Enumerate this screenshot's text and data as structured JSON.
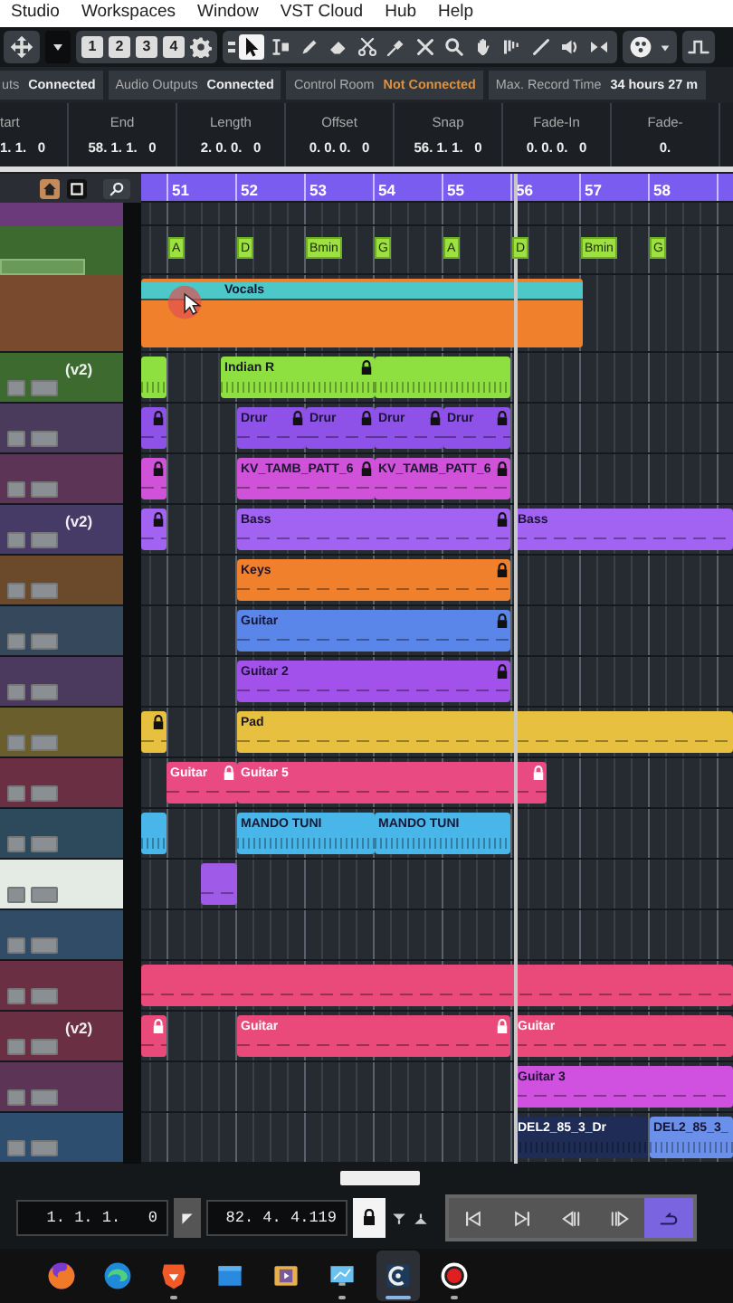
{
  "menu": [
    "Studio",
    "Workspaces",
    "Window",
    "VST Cloud",
    "Hub",
    "Help"
  ],
  "toolbar": {
    "keys": [
      "1",
      "2",
      "3",
      "4"
    ],
    "tools": [
      {
        "kind": "select",
        "selected": true
      },
      {
        "kind": "range",
        "selected": false
      },
      {
        "kind": "pencil",
        "selected": false
      },
      {
        "kind": "eraser",
        "selected": false
      },
      {
        "kind": "scissors",
        "selected": false
      },
      {
        "kind": "glue",
        "selected": false
      },
      {
        "kind": "mute",
        "selected": false
      },
      {
        "kind": "zoom",
        "selected": false
      },
      {
        "kind": "hand",
        "selected": false
      },
      {
        "kind": "comp",
        "selected": false
      },
      {
        "kind": "line",
        "selected": false
      },
      {
        "kind": "speaker",
        "selected": false
      },
      {
        "kind": "play",
        "selected": false
      }
    ]
  },
  "connections": [
    {
      "label": "uts",
      "value": "Connected",
      "connected": true
    },
    {
      "label": "Audio Outputs",
      "value": "Connected",
      "connected": true
    },
    {
      "label": "Control Room",
      "value": "Not Connected",
      "connected": false
    }
  ],
  "record_time": {
    "label": "Max. Record Time",
    "value": "34 hours 27 m"
  },
  "info_line": [
    {
      "label": "tart",
      "value": "1. 1.   0"
    },
    {
      "label": "End",
      "value": "58. 1. 1.   0"
    },
    {
      "label": "Length",
      "value": "2. 0. 0.   0"
    },
    {
      "label": "Offset",
      "value": "0. 0. 0.   0"
    },
    {
      "label": "Snap",
      "value": "56. 1. 1.   0"
    },
    {
      "label": "Fade-In",
      "value": "0. 0. 0.   0"
    },
    {
      "label": "Fade-",
      "value": "0."
    }
  ],
  "ruler": {
    "bars": [
      "51",
      "52",
      "53",
      "54",
      "55",
      "56",
      "57",
      "58"
    ]
  },
  "chords": [
    {
      "label": "A"
    },
    {
      "label": "D"
    },
    {
      "label": "Bmin"
    },
    {
      "label": "G"
    },
    {
      "label": "A"
    },
    {
      "label": "D"
    },
    {
      "label": "Bmin"
    },
    {
      "label": "G"
    }
  ],
  "tracks": [
    {
      "color": "#7a4a2e",
      "events": [
        {
          "kind": "comped",
          "label": "Vocals",
          "color": "#f0802c",
          "locked": false
        }
      ]
    },
    {
      "color": "#3d6b2f",
      "version": "(v2)",
      "events": [
        {
          "kind": "audio",
          "color": "#8ee040",
          "locked": false
        },
        {
          "kind": "audio",
          "label": "Indian R",
          "color": "#8ee040",
          "locked": true
        },
        {
          "kind": "audio",
          "color": "#8ee040",
          "locked": false
        }
      ]
    },
    {
      "color": "#4a3a5c",
      "events": [
        {
          "kind": "midi",
          "color": "#8f52e8",
          "locked": true
        },
        {
          "kind": "midi",
          "label": "Drur",
          "color": "#8f52e8",
          "locked": true
        },
        {
          "kind": "midi",
          "label": "Drur",
          "color": "#8f52e8",
          "locked": true
        },
        {
          "kind": "midi",
          "label": "Drur",
          "color": "#8f52e8",
          "locked": true
        },
        {
          "kind": "midi",
          "label": "Drur",
          "color": "#8f52e8",
          "locked": true
        }
      ]
    },
    {
      "color": "#5c3556",
      "events": [
        {
          "kind": "midi",
          "color": "#cf52d8",
          "locked": true
        },
        {
          "kind": "midi",
          "label": "KV_TAMB_PATT_6",
          "color": "#cf52d8",
          "locked": true
        },
        {
          "kind": "midi",
          "label": "KV_TAMB_PATT_6",
          "color": "#cf52d8",
          "locked": true
        }
      ]
    },
    {
      "color": "#463a66",
      "version": "(v2)",
      "events": [
        {
          "kind": "midi",
          "color": "#a262f2",
          "locked": true
        },
        {
          "kind": "midi",
          "label": "Bass",
          "color": "#a262f2",
          "locked": true
        },
        {
          "kind": "midi",
          "label": "Bass",
          "color": "#a262f2",
          "locked": false
        }
      ]
    },
    {
      "color": "#6b4a2c",
      "events": [
        {
          "kind": "midi",
          "label": "Keys",
          "color": "#f0802c",
          "locked": true
        }
      ]
    },
    {
      "color": "#35485c",
      "events": [
        {
          "kind": "midi",
          "label": "Guitar",
          "color": "#5a86ea",
          "locked": true
        }
      ]
    },
    {
      "color": "#4c3a5e",
      "events": [
        {
          "kind": "midi",
          "label": "Guitar 2",
          "color": "#a252ea",
          "locked": true
        }
      ]
    },
    {
      "color": "#6a5f2c",
      "events": [
        {
          "kind": "midi",
          "color": "#e8c040",
          "locked": true
        },
        {
          "kind": "midi",
          "label": "Pad",
          "color": "#e8c040",
          "locked": false
        }
      ]
    },
    {
      "color": "#6a2f42",
      "events": [
        {
          "kind": "midi",
          "label": "Guitar",
          "color": "#ea4a82",
          "locked": true
        },
        {
          "kind": "midi",
          "label": "Guitar 5",
          "color": "#ea4a82",
          "locked": true
        }
      ]
    },
    {
      "color": "#2c4a5c",
      "events": [
        {
          "kind": "audio",
          "color": "#48b6e8",
          "locked": false
        },
        {
          "kind": "audio",
          "label": "MANDO TUNI",
          "color": "#48b6e8",
          "locked": false
        },
        {
          "kind": "audio",
          "label": "MANDO TUNI",
          "color": "#48b6e8",
          "locked": false
        }
      ]
    },
    {
      "color": "#e4ebe4",
      "events": [
        {
          "kind": "midi",
          "color": "#a05ae8",
          "locked": false
        }
      ]
    },
    {
      "color": "#304c66"
    },
    {
      "color": "#6a2f42",
      "events": [
        {
          "kind": "midi",
          "color": "#ea4a7a",
          "locked": false
        }
      ]
    },
    {
      "color": "#6a2f42",
      "version": "(v2)",
      "events": [
        {
          "kind": "midi",
          "color": "#ea4a7a",
          "locked": true
        },
        {
          "kind": "midi",
          "label": "Guitar",
          "color": "#ea4a7a",
          "locked": true
        },
        {
          "kind": "midi",
          "label": "Guitar",
          "color": "#ea4a7a",
          "locked": false
        }
      ]
    },
    {
      "color": "#5c3456",
      "events": [
        {
          "kind": "midi",
          "label": "Guitar 3",
          "color": "#d050e0",
          "locked": false
        }
      ]
    },
    {
      "color": "#2d4e6e",
      "events": [
        {
          "kind": "audio",
          "label": "DEL2_85_3_Dr",
          "color": "#1f2c55",
          "locked": false
        },
        {
          "kind": "audio",
          "label": "DEL2_85_3_",
          "color": "#6a90ea",
          "locked": false
        }
      ]
    }
  ],
  "transport": {
    "left_locator": "1. 1. 1.   0",
    "right_locator": "82. 4. 4.119",
    "locked": true,
    "buttons": [
      {
        "kind": "prev",
        "selected": false
      },
      {
        "kind": "next",
        "selected": false
      },
      {
        "kind": "back",
        "selected": false
      },
      {
        "kind": "fwd",
        "selected": false
      },
      {
        "kind": "cycle",
        "selected": true
      }
    ]
  },
  "taskbar": [
    {
      "kind": "fox",
      "selected": false,
      "running": false
    },
    {
      "kind": "wave",
      "selected": false,
      "running": false
    },
    {
      "kind": "lion",
      "selected": false,
      "running": true
    },
    {
      "kind": "tile",
      "selected": false,
      "running": false
    },
    {
      "kind": "player",
      "selected": false,
      "running": false
    },
    {
      "kind": "monitor",
      "selected": false,
      "running": true
    },
    {
      "kind": "daw",
      "selected": true,
      "running": true
    },
    {
      "kind": "record",
      "selected": false,
      "running": true
    }
  ]
}
